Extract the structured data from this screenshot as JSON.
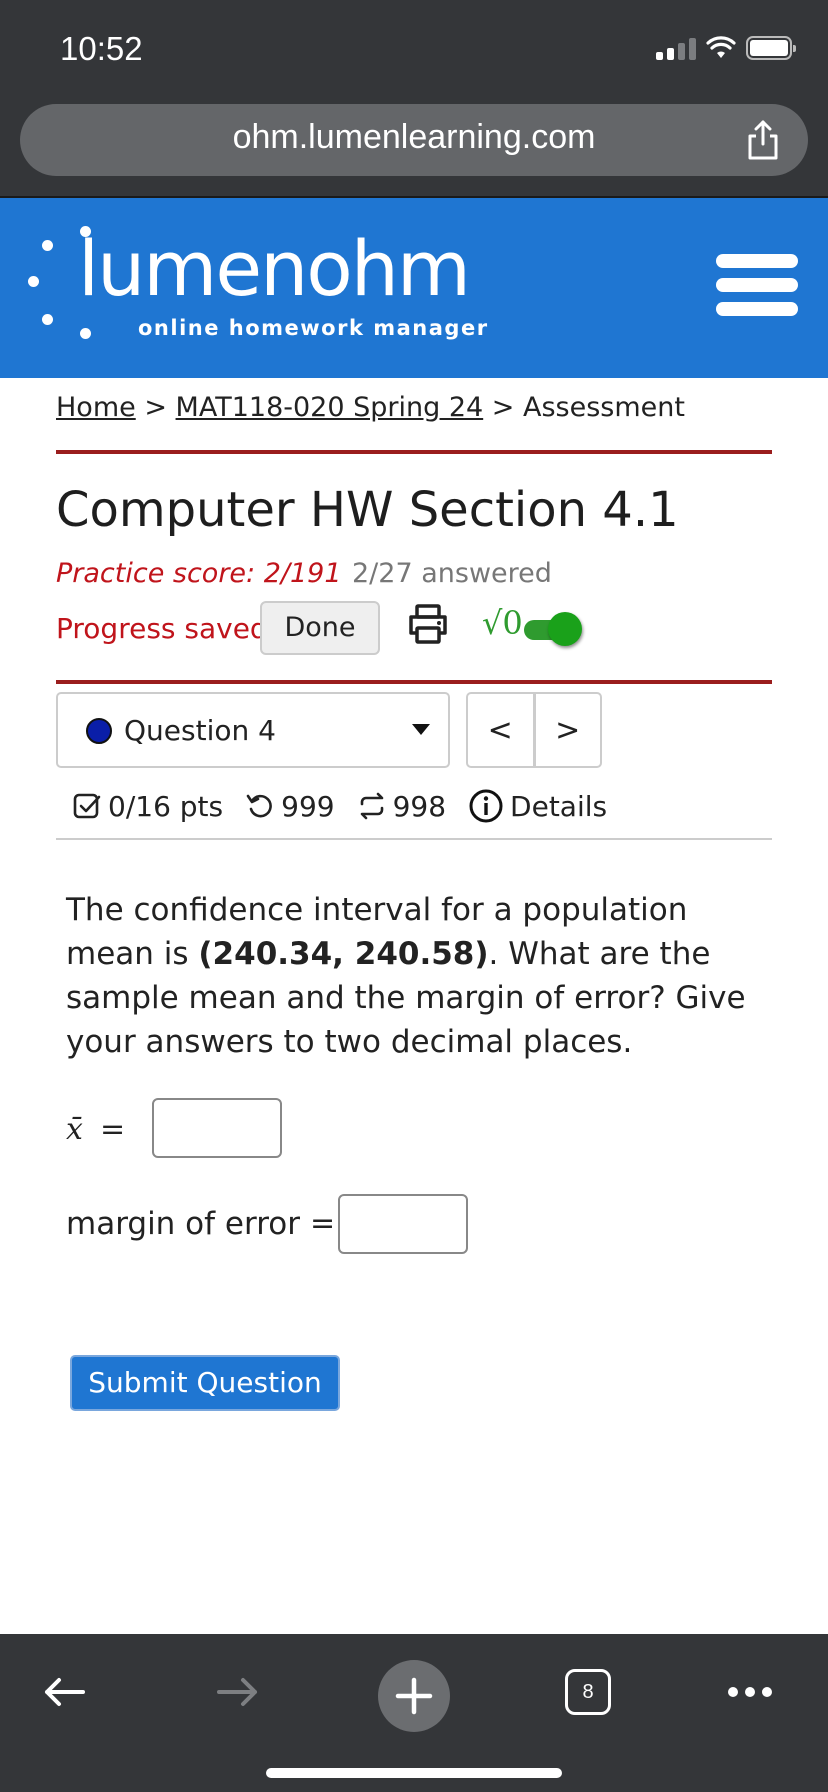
{
  "status_bar": {
    "time": "10:52"
  },
  "browser": {
    "url": "ohm.lumenlearning.com",
    "tab_count": "8"
  },
  "brand": {
    "name": "lumenohm",
    "tagline": "online homework manager",
    "color": "#1f76d2"
  },
  "breadcrumb": {
    "home": "Home",
    "separator": ">",
    "course": "MAT118-020 Spring 24",
    "current": "Assessment"
  },
  "assessment": {
    "title": "Computer HW Section 4.1",
    "practice_score": "Practice score: 2/191",
    "answered": "2/27 answered",
    "progress_status": "Progress saved",
    "done_label": "Done",
    "math_toggle_label": "√0"
  },
  "question_nav": {
    "selected": "Question 4",
    "prev": "<",
    "next": ">"
  },
  "question_meta": {
    "points": "0/16 pts",
    "attempts": "999",
    "regens": "998",
    "details": "Details"
  },
  "question": {
    "text_before": "The confidence interval for a population mean is ",
    "interval": "(240.34, 240.58)",
    "text_after": ". What are the sample mean and the margin of error? Give your answers to two decimal places.",
    "xbar_label": "x̄",
    "equals": "=",
    "moe_label": "margin of error",
    "xbar_value": "",
    "moe_value": "",
    "submit_label": "Submit Question"
  },
  "colors": {
    "accent_red": "#c0141b",
    "rule_red": "#9a1d1d",
    "toggle_green": "#2f9b2f",
    "question_dot": "#0a1ea8"
  },
  "icons": [
    "share-icon",
    "menu-icon",
    "print-icon",
    "checkbox-icon",
    "retry-icon",
    "regen-icon",
    "info-icon",
    "back-arrow-icon",
    "forward-arrow-icon",
    "plus-icon",
    "tabs-icon",
    "more-icon"
  ]
}
